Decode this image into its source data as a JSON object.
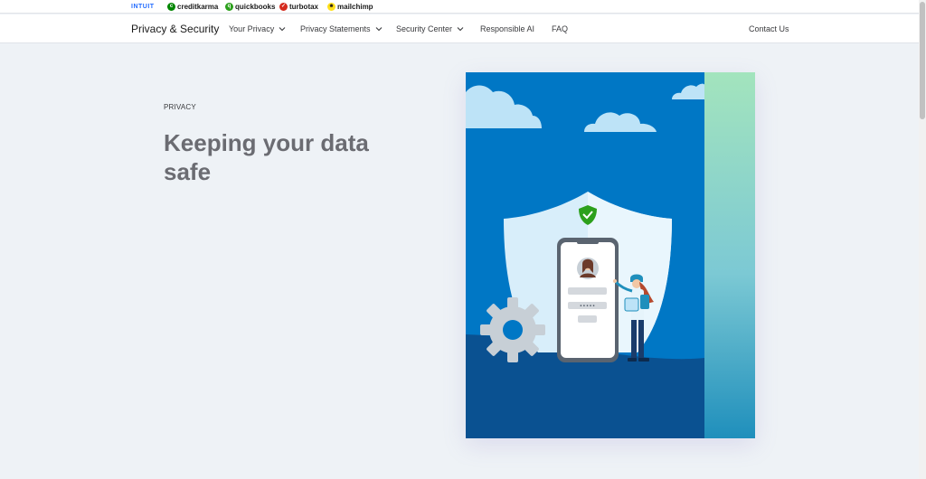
{
  "brands": {
    "intuit": "INTUIT",
    "creditkarma": "creditkarma",
    "quickbooks": "quickbooks",
    "turbotax": "turbotax",
    "mailchimp": "mailchimp"
  },
  "nav": {
    "title": "Privacy & Security",
    "items": [
      {
        "label": "Your Privacy"
      },
      {
        "label": "Privacy Statements"
      },
      {
        "label": "Security Center"
      },
      {
        "label": "Responsible AI"
      },
      {
        "label": "FAQ"
      }
    ],
    "contact": "Contact Us"
  },
  "hero": {
    "eyebrow": "PRIVACY",
    "headline": "Keeping your data safe",
    "illustration": "shield-phone-gear-illustration"
  },
  "colors": {
    "background": "#eef2f6",
    "hero_blue": "#0077c5",
    "hero_dark_blue": "#0a5191",
    "accent_green": "#2ca01c",
    "intuit_blue": "#236cff"
  }
}
